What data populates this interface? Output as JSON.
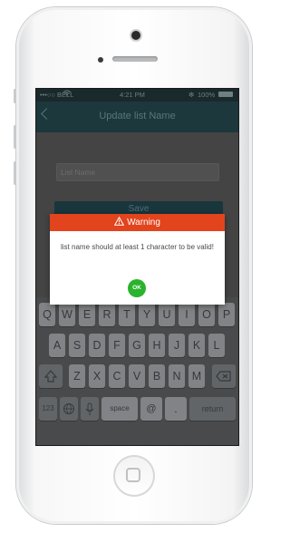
{
  "status_bar": {
    "carrier": "•••○○ BELL",
    "time": "4:21 PM",
    "battery": "100%"
  },
  "nav": {
    "title": "Update list Name",
    "back_icon": "chevron-left-icon"
  },
  "form": {
    "input_placeholder": "List Name",
    "save_label": "Save"
  },
  "dialog": {
    "title": "Warning",
    "message": "list name should at least 1 character to be valid!",
    "ok_label": "OK",
    "colors": {
      "header": "#e2441d",
      "ok": "#2ab32c"
    }
  },
  "keyboard": {
    "row1": [
      "Q",
      "W",
      "E",
      "R",
      "T",
      "Y",
      "U",
      "I",
      "O",
      "P"
    ],
    "row2": [
      "A",
      "S",
      "D",
      "F",
      "G",
      "H",
      "J",
      "K",
      "L"
    ],
    "row3": [
      "Z",
      "X",
      "C",
      "V",
      "B",
      "N",
      "M"
    ],
    "numbers_label": "123",
    "space_label": "space",
    "at_label": "@",
    "period_label": ".",
    "return_label": "return",
    "shift_icon": "shift-icon",
    "delete_icon": "delete-icon",
    "globe_icon": "globe-icon",
    "mic_icon": "microphone-icon"
  }
}
